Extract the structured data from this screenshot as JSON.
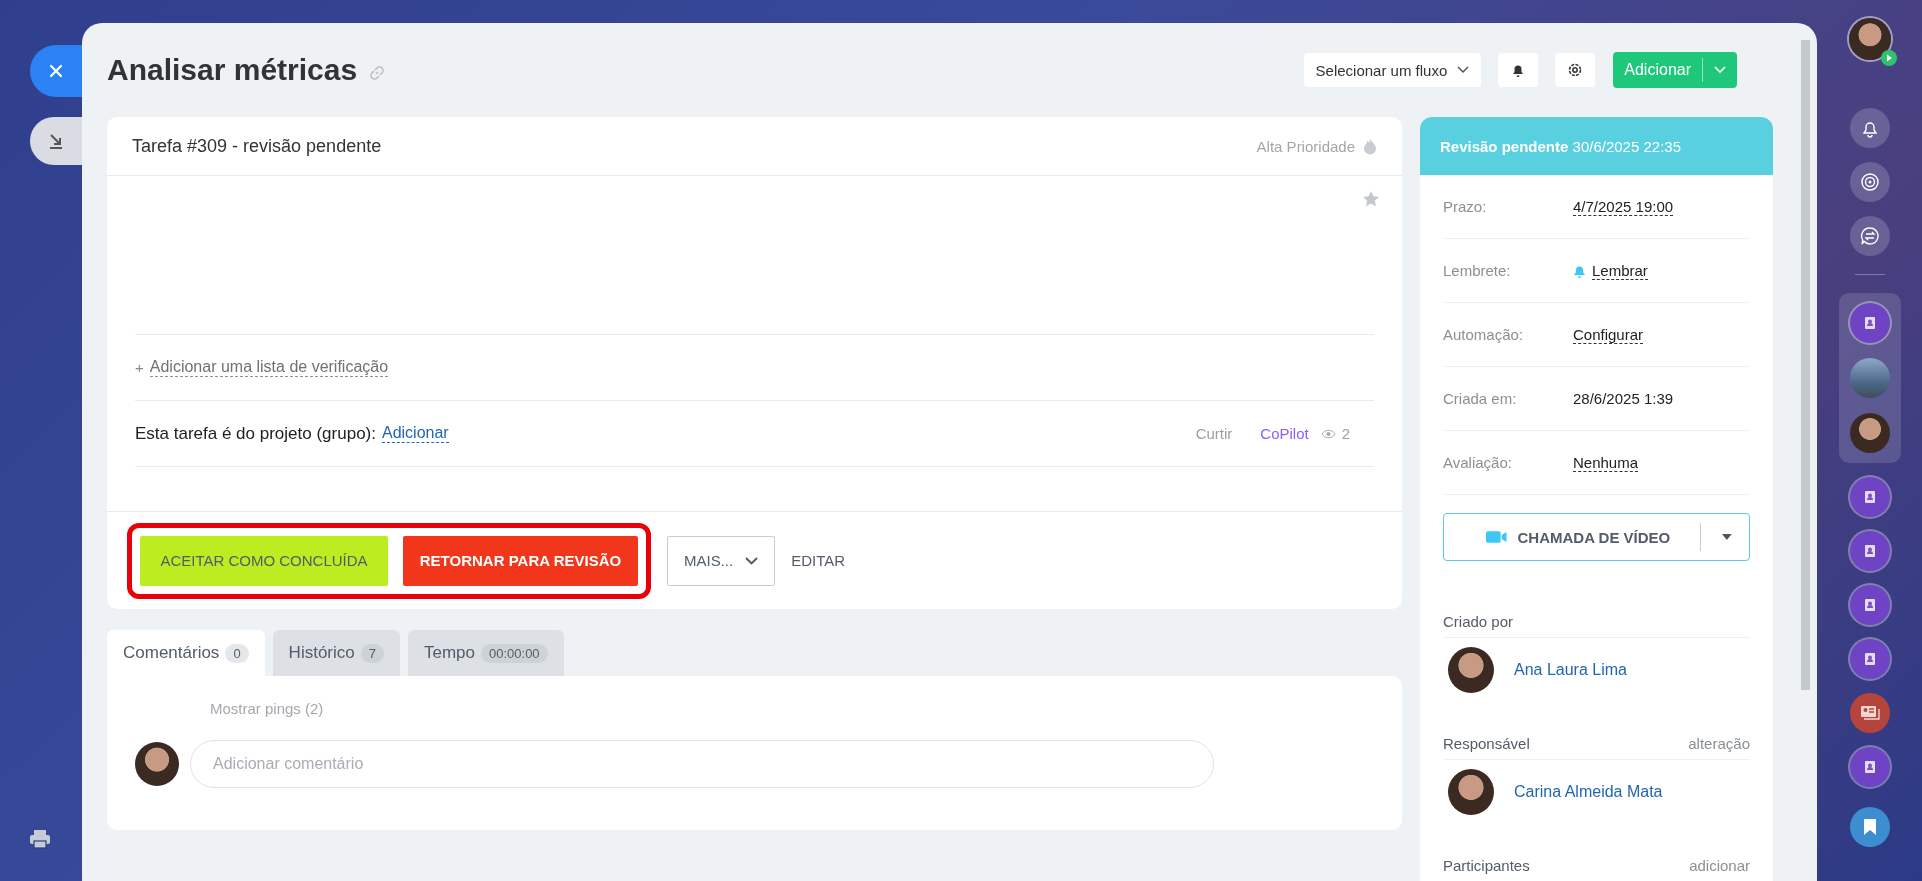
{
  "header": {
    "title": "Analisar métricas",
    "flow_select": "Selecionar um fluxo",
    "add_button": "Adicionar"
  },
  "task": {
    "heading": "Tarefa #309 - revisão pendente",
    "priority": "Alta Prioridade",
    "checklist_plus": "+",
    "checklist_link": "Adicionar uma lista de verificação",
    "project_label": "Esta tarefa é do projeto (grupo):",
    "project_link": "Adicionar",
    "like": "Curtir",
    "copilot": "CoPilot",
    "views": "2"
  },
  "actions": [
    {
      "label": "ACEITAR COMO CONCLUÍDA",
      "kind": "accept"
    },
    {
      "label": "RETORNAR PARA REVISÃO",
      "kind": "return"
    },
    {
      "label": "MAIS...",
      "kind": "more"
    },
    {
      "label": "EDITAR",
      "kind": "plain"
    }
  ],
  "tabs": [
    {
      "label": "Comentários",
      "count": "0",
      "selected": true
    },
    {
      "label": "Histórico",
      "count": "7",
      "selected": false
    },
    {
      "label": "Tempo",
      "count": "00:00:00",
      "selected": false
    }
  ],
  "comments": {
    "pings": "Mostrar pings (2)",
    "placeholder": "Adicionar comentário"
  },
  "status": {
    "label": "Revisão pendente",
    "date": "30/6/2025 22:35"
  },
  "fields": [
    {
      "label": "Prazo:",
      "value": "4/7/2025 19:00",
      "kind": "link"
    },
    {
      "label": "Lembrete:",
      "value": "Lembrar",
      "kind": "reminder"
    },
    {
      "label": "Automação:",
      "value": "Configurar",
      "kind": "link"
    },
    {
      "label": "Criada em:",
      "value": "28/6/2025 1:39",
      "kind": "plain"
    },
    {
      "label": "Avaliação:",
      "value": "Nenhuma",
      "kind": "link"
    }
  ],
  "video_call": "CHAMADA DE VÍDEO",
  "people": [
    {
      "title": "Criado por",
      "person": "Ana Laura Lima"
    },
    {
      "title": "Responsável",
      "action": "alteração",
      "person": "Carina Almeida Mata"
    },
    {
      "title": "Participantes",
      "action": "adicionar"
    }
  ]
}
